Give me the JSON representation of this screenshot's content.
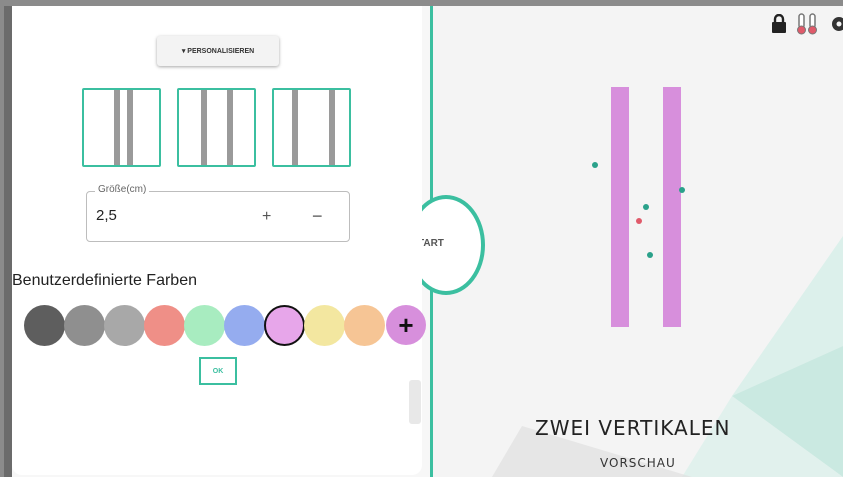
{
  "panel": {
    "personalize_label": "▾ PERSONALISIEREN",
    "size_field": {
      "legend": "Größe(cm)",
      "value": "2,5",
      "plus": "+",
      "minus": "−"
    },
    "custom_colors_title": "Benutzerdefinierte Farben",
    "swatches": [
      {
        "name": "dark-gray",
        "color": "#5e5e5e"
      },
      {
        "name": "gray",
        "color": "#8f8f8f"
      },
      {
        "name": "light-gray",
        "color": "#a8a8a8"
      },
      {
        "name": "salmon",
        "color": "#ef8f87"
      },
      {
        "name": "mint",
        "color": "#a8ecc0"
      },
      {
        "name": "blue",
        "color": "#95acef"
      },
      {
        "name": "violet",
        "color": "#e7a6ea",
        "selected": true
      },
      {
        "name": "yellow",
        "color": "#f3e7a0"
      },
      {
        "name": "peach",
        "color": "#f6c595"
      }
    ],
    "add_label": "+",
    "ok_label": "OK"
  },
  "start": {
    "label": "TART"
  },
  "preview": {
    "title": "ZWEI VERTIKALEN",
    "subtitle": "VORSCHAU",
    "bar_color": "#d78fdc",
    "dot_colors": {
      "teal": "#2aa18a",
      "red": "#e05a6a"
    },
    "icons": [
      "lock-icon",
      "thermometer-icon",
      "gear-icon"
    ]
  },
  "colors": {
    "accent": "#3bbfa0"
  }
}
